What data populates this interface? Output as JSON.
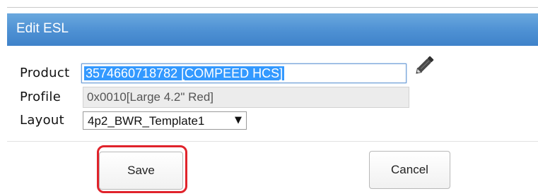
{
  "dialog": {
    "title": "Edit ESL"
  },
  "fields": {
    "product_label": "Product",
    "product_value": "3574660718782 [COMPEED HCS]",
    "profile_label": "Profile",
    "profile_value": "0x0010[Large 4.2\" Red]",
    "layout_label": "Layout",
    "layout_value": "4p2_BWR_Template1",
    "layout_arrow": "▼"
  },
  "icons": {
    "edit": "pencil-icon"
  },
  "buttons": {
    "save_label": "Save",
    "cancel_label": "Cancel"
  },
  "colors": {
    "titlebar": "#4d90d3",
    "selection": "#3399ff",
    "highlight_ring": "#e0232b"
  }
}
